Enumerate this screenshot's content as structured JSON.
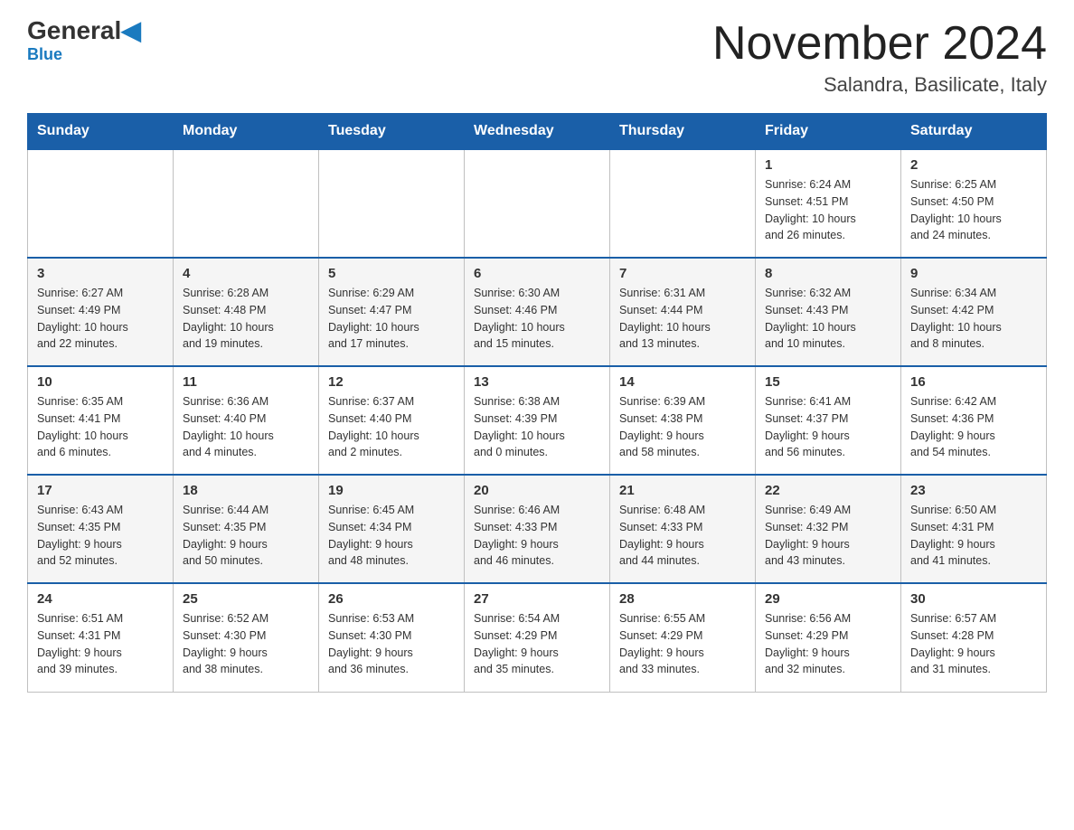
{
  "logo": {
    "text1": "General",
    "text2": "Blue"
  },
  "title": "November 2024",
  "subtitle": "Salandra, Basilicate, Italy",
  "days_of_week": [
    "Sunday",
    "Monday",
    "Tuesday",
    "Wednesday",
    "Thursday",
    "Friday",
    "Saturday"
  ],
  "weeks": [
    [
      {
        "day": "",
        "info": ""
      },
      {
        "day": "",
        "info": ""
      },
      {
        "day": "",
        "info": ""
      },
      {
        "day": "",
        "info": ""
      },
      {
        "day": "",
        "info": ""
      },
      {
        "day": "1",
        "info": "Sunrise: 6:24 AM\nSunset: 4:51 PM\nDaylight: 10 hours\nand 26 minutes."
      },
      {
        "day": "2",
        "info": "Sunrise: 6:25 AM\nSunset: 4:50 PM\nDaylight: 10 hours\nand 24 minutes."
      }
    ],
    [
      {
        "day": "3",
        "info": "Sunrise: 6:27 AM\nSunset: 4:49 PM\nDaylight: 10 hours\nand 22 minutes."
      },
      {
        "day": "4",
        "info": "Sunrise: 6:28 AM\nSunset: 4:48 PM\nDaylight: 10 hours\nand 19 minutes."
      },
      {
        "day": "5",
        "info": "Sunrise: 6:29 AM\nSunset: 4:47 PM\nDaylight: 10 hours\nand 17 minutes."
      },
      {
        "day": "6",
        "info": "Sunrise: 6:30 AM\nSunset: 4:46 PM\nDaylight: 10 hours\nand 15 minutes."
      },
      {
        "day": "7",
        "info": "Sunrise: 6:31 AM\nSunset: 4:44 PM\nDaylight: 10 hours\nand 13 minutes."
      },
      {
        "day": "8",
        "info": "Sunrise: 6:32 AM\nSunset: 4:43 PM\nDaylight: 10 hours\nand 10 minutes."
      },
      {
        "day": "9",
        "info": "Sunrise: 6:34 AM\nSunset: 4:42 PM\nDaylight: 10 hours\nand 8 minutes."
      }
    ],
    [
      {
        "day": "10",
        "info": "Sunrise: 6:35 AM\nSunset: 4:41 PM\nDaylight: 10 hours\nand 6 minutes."
      },
      {
        "day": "11",
        "info": "Sunrise: 6:36 AM\nSunset: 4:40 PM\nDaylight: 10 hours\nand 4 minutes."
      },
      {
        "day": "12",
        "info": "Sunrise: 6:37 AM\nSunset: 4:40 PM\nDaylight: 10 hours\nand 2 minutes."
      },
      {
        "day": "13",
        "info": "Sunrise: 6:38 AM\nSunset: 4:39 PM\nDaylight: 10 hours\nand 0 minutes."
      },
      {
        "day": "14",
        "info": "Sunrise: 6:39 AM\nSunset: 4:38 PM\nDaylight: 9 hours\nand 58 minutes."
      },
      {
        "day": "15",
        "info": "Sunrise: 6:41 AM\nSunset: 4:37 PM\nDaylight: 9 hours\nand 56 minutes."
      },
      {
        "day": "16",
        "info": "Sunrise: 6:42 AM\nSunset: 4:36 PM\nDaylight: 9 hours\nand 54 minutes."
      }
    ],
    [
      {
        "day": "17",
        "info": "Sunrise: 6:43 AM\nSunset: 4:35 PM\nDaylight: 9 hours\nand 52 minutes."
      },
      {
        "day": "18",
        "info": "Sunrise: 6:44 AM\nSunset: 4:35 PM\nDaylight: 9 hours\nand 50 minutes."
      },
      {
        "day": "19",
        "info": "Sunrise: 6:45 AM\nSunset: 4:34 PM\nDaylight: 9 hours\nand 48 minutes."
      },
      {
        "day": "20",
        "info": "Sunrise: 6:46 AM\nSunset: 4:33 PM\nDaylight: 9 hours\nand 46 minutes."
      },
      {
        "day": "21",
        "info": "Sunrise: 6:48 AM\nSunset: 4:33 PM\nDaylight: 9 hours\nand 44 minutes."
      },
      {
        "day": "22",
        "info": "Sunrise: 6:49 AM\nSunset: 4:32 PM\nDaylight: 9 hours\nand 43 minutes."
      },
      {
        "day": "23",
        "info": "Sunrise: 6:50 AM\nSunset: 4:31 PM\nDaylight: 9 hours\nand 41 minutes."
      }
    ],
    [
      {
        "day": "24",
        "info": "Sunrise: 6:51 AM\nSunset: 4:31 PM\nDaylight: 9 hours\nand 39 minutes."
      },
      {
        "day": "25",
        "info": "Sunrise: 6:52 AM\nSunset: 4:30 PM\nDaylight: 9 hours\nand 38 minutes."
      },
      {
        "day": "26",
        "info": "Sunrise: 6:53 AM\nSunset: 4:30 PM\nDaylight: 9 hours\nand 36 minutes."
      },
      {
        "day": "27",
        "info": "Sunrise: 6:54 AM\nSunset: 4:29 PM\nDaylight: 9 hours\nand 35 minutes."
      },
      {
        "day": "28",
        "info": "Sunrise: 6:55 AM\nSunset: 4:29 PM\nDaylight: 9 hours\nand 33 minutes."
      },
      {
        "day": "29",
        "info": "Sunrise: 6:56 AM\nSunset: 4:29 PM\nDaylight: 9 hours\nand 32 minutes."
      },
      {
        "day": "30",
        "info": "Sunrise: 6:57 AM\nSunset: 4:28 PM\nDaylight: 9 hours\nand 31 minutes."
      }
    ]
  ]
}
